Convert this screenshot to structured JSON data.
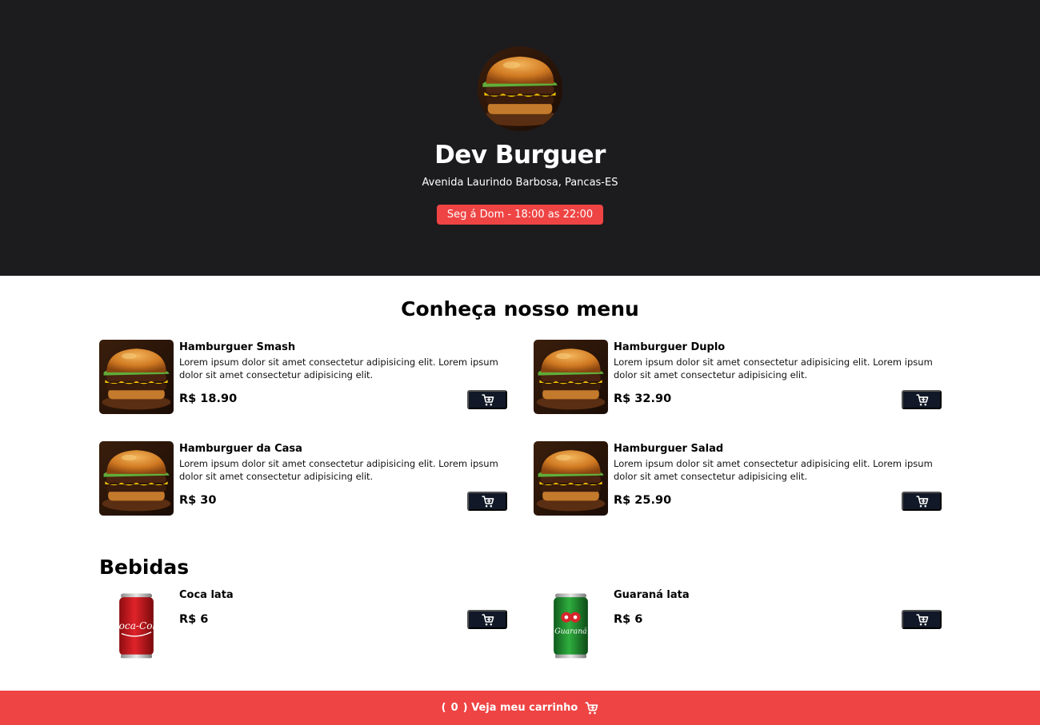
{
  "header": {
    "store_name": "Dev Burguer",
    "address": "Avenida Laurindo Barbosa, Pancas-ES",
    "hours": "Seg á Dom - 18:00 as 22:00"
  },
  "menu": {
    "title": "Conheça nosso menu",
    "burgers": [
      {
        "name": "Hamburguer Smash",
        "description": "Lorem ipsum dolor sit amet consectetur adipisicing elit. Lorem ipsum dolor sit amet consectetur adipisicing elit.",
        "price": "R$ 18.90"
      },
      {
        "name": "Hamburguer Duplo",
        "description": "Lorem ipsum dolor sit amet consectetur adipisicing elit. Lorem ipsum dolor sit amet consectetur adipisicing elit.",
        "price": "R$ 32.90"
      },
      {
        "name": "Hamburguer da Casa",
        "description": "Lorem ipsum dolor sit amet consectetur adipisicing elit. Lorem ipsum dolor sit amet consectetur adipisicing elit.",
        "price": "R$ 30"
      },
      {
        "name": "Hamburguer Salad",
        "description": "Lorem ipsum dolor sit amet consectetur adipisicing elit. Lorem ipsum dolor sit amet consectetur adipisicing elit.",
        "price": "R$ 25.90"
      }
    ]
  },
  "drinks": {
    "title": "Bebidas",
    "items": [
      {
        "name": "Coca lata",
        "price": "R$ 6",
        "can_brand": "Coca-Cola"
      },
      {
        "name": "Guaraná lata",
        "price": "R$ 6",
        "can_brand": "Guaraná"
      }
    ]
  },
  "footer": {
    "open_paren": "(",
    "count": "0",
    "label": ") Veja meu carrinho"
  },
  "colors": {
    "hero_bg": "#1c1b1e",
    "accent": "#ef4444",
    "button_bg": "#111827"
  },
  "icons": {
    "cart": "cart-plus-icon",
    "footer_cart": "cart-icon"
  }
}
